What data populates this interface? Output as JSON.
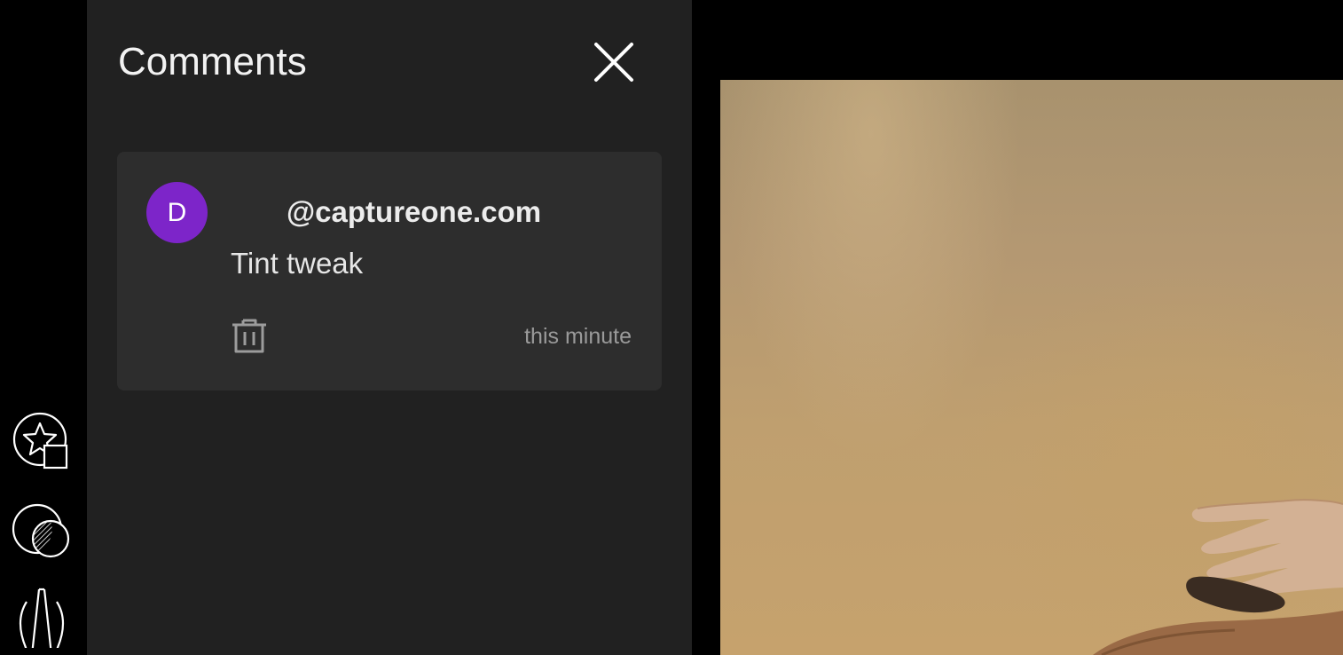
{
  "tool_rail": {
    "tools": [
      {
        "icon": "star-rating-icon"
      },
      {
        "icon": "mask-layer-icon"
      },
      {
        "icon": "perspective-icon"
      }
    ]
  },
  "comments_panel": {
    "title": "Comments",
    "close_icon": "close-icon",
    "comments": [
      {
        "avatar_letter": "D",
        "avatar_color": "#7d25c9",
        "author": "@captureone.com",
        "text": "Tint tweak",
        "timestamp": "this minute",
        "delete_icon": "trash-icon"
      }
    ]
  },
  "canvas": {
    "image": "photo-preview"
  },
  "colors": {
    "panel_bg": "#212121",
    "card_bg": "#2d2d2d",
    "accent_avatar": "#7d25c9",
    "rail_bg": "#000000"
  }
}
